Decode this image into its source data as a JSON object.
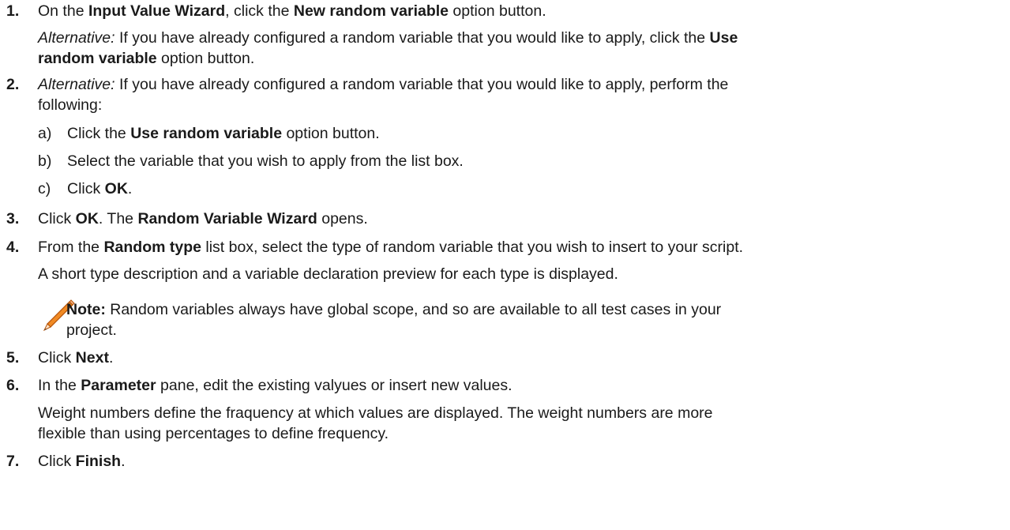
{
  "steps": {
    "s1": {
      "num": "1.",
      "a": "On the ",
      "b": "Input Value Wizard",
      "c": ", click the ",
      "d": "New random variable",
      "e": " option button.",
      "alt_label": "Alternative:",
      "alt_text": " If you have already configured a random variable that you would like to apply, click the ",
      "alt_bold": "Use",
      "alt_line2_bold": "random variable",
      "alt_line2_text": " option button."
    },
    "s2": {
      "num": "2.",
      "alt_label": "Alternative:",
      "text1": " If you have already configured a random variable that you would like to apply, perform the",
      "text2": "following:",
      "subs": [
        {
          "letter": "a)",
          "pre": "Click the ",
          "bold": "Use random variable",
          "post": " option button."
        },
        {
          "letter": "b)",
          "pre": "Select the variable that you wish to apply from the list box.",
          "bold": "",
          "post": ""
        },
        {
          "letter": "c)",
          "pre": "Click ",
          "bold": "OK",
          "post": "."
        }
      ]
    },
    "s3": {
      "num": "3.",
      "a": "Click ",
      "b": "OK",
      "c": ". The ",
      "d": "Random Variable Wizard",
      "e": " opens."
    },
    "s4": {
      "num": "4.",
      "a": "From the ",
      "b": "Random type",
      "c": " list box, select the type of random variable that you wish to insert to your script.",
      "desc": "A short type description and a variable declaration preview for each type is displayed.",
      "note_label": "Note:",
      "note_text1": " Random variables always have global scope, and so are available to all test cases in your",
      "note_text2": "project."
    },
    "s5": {
      "num": "5.",
      "a": "Click ",
      "b": "Next",
      "c": "."
    },
    "s6": {
      "num": "6.",
      "a": "In the ",
      "b": "Parameter",
      "c": " pane, edit the existing valyues or insert new values.",
      "desc1": "Weight numbers define the fraquency at which values are displayed. The weight numbers are more",
      "desc2": "flexible than using percentages to define frequency."
    },
    "s7": {
      "num": "7.",
      "a": "Click ",
      "b": "Finish",
      "c": "."
    }
  },
  "icons": {
    "note": "pencil-note-icon"
  },
  "colors": {
    "text": "#1a1a1a",
    "pencil_body": "#f08a24",
    "pencil_tip": "#c65a12"
  }
}
